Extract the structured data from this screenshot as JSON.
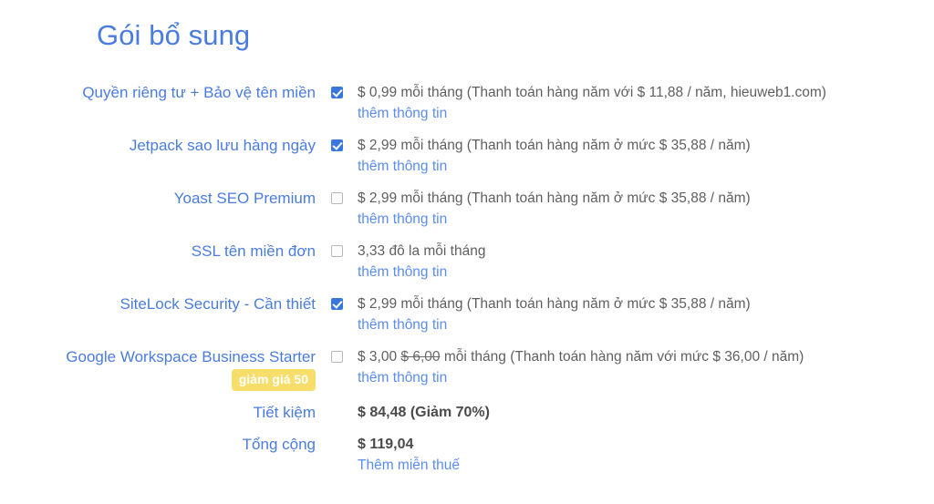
{
  "page": {
    "title": "Gói bổ sung",
    "title_color": "#4a7ce0",
    "link_color": "#5b8def",
    "checkbox_checked_color": "#3a77dd",
    "badge_color": "#f7dd6a"
  },
  "more_info_label": "thêm thông tin",
  "addons": [
    {
      "label": "Quyền riêng tư + Bảo vệ tên miền",
      "checked": true,
      "checkbox_icon": "checkbox-checked-icon",
      "price_text": "$ 0,99 mỗi tháng (Thanh toán hàng năm với $ 11,88 / năm, hieuweb1.com)",
      "old_price": "",
      "badge": ""
    },
    {
      "label": "Jetpack sao lưu hàng ngày",
      "checked": true,
      "checkbox_icon": "checkbox-checked-icon",
      "price_text": "$ 2,99 mỗi tháng (Thanh toán hàng năm ở mức $ 35,88 / năm)",
      "old_price": "",
      "badge": ""
    },
    {
      "label": "Yoast SEO Premium",
      "checked": false,
      "checkbox_icon": "checkbox-unchecked-icon",
      "price_text": "$ 2,99 mỗi tháng (Thanh toán hàng năm ở mức $ 35,88 / năm)",
      "old_price": "",
      "badge": ""
    },
    {
      "label": "SSL tên miền đơn",
      "checked": false,
      "checkbox_icon": "checkbox-unchecked-icon",
      "price_text": "3,33 đô la mỗi tháng",
      "old_price": "",
      "badge": ""
    },
    {
      "label": "SiteLock Security - Cần thiết",
      "checked": true,
      "checkbox_icon": "checkbox-checked-icon",
      "price_text": "$ 2,99 mỗi tháng (Thanh toán hàng năm ở mức $ 35,88 / năm)",
      "old_price": "",
      "badge": ""
    },
    {
      "label": "Google Workspace Business Starter",
      "checked": false,
      "checkbox_icon": "checkbox-unchecked-icon",
      "price_prefix": "$ 3,00",
      "old_price": "$ 6,00",
      "price_suffix": "mỗi tháng (Thanh toán hàng năm với mức $ 36,00 / năm)",
      "price_text": "",
      "badge": "giảm giá 50"
    }
  ],
  "summary": {
    "savings_label": "Tiết kiệm",
    "savings_value": "$ 84,48 (Giảm 70%)",
    "total_label": "Tổng cộng",
    "total_value": "$ 119,04",
    "tax_link": "Thêm miễn thuế"
  }
}
